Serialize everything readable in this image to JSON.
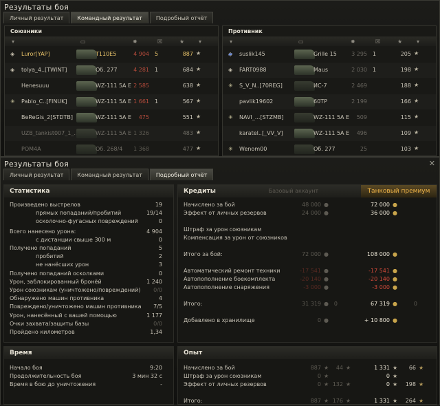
{
  "window1": {
    "title": "Результаты боя",
    "tabs": [
      "Личный результат",
      "Командный результат",
      "Подробный отчёт"
    ],
    "allies_label": "Союзники",
    "enemies_label": "Противник",
    "allies": [
      {
        "name": "Luror[YAP]",
        "tank": "T110E5",
        "damage": "4 904",
        "frags": "5",
        "xp": "887"
      },
      {
        "name": "tolya_4..[TWINT]",
        "tank": "Об. 277",
        "damage": "4 281",
        "frags": "1",
        "xp": "684"
      },
      {
        "name": "Henesuuu",
        "tank": "WZ-111 5A E",
        "damage": "2 585",
        "frags": "",
        "xp": "638"
      },
      {
        "name": "Pablo_C..[FINUK]",
        "tank": "WZ-111 5A E",
        "damage": "1 661",
        "frags": "1",
        "xp": "567"
      },
      {
        "name": "BeReGis_2[STDTB]",
        "tank": "WZ-111 5A E",
        "damage": "475",
        "frags": "",
        "xp": "551"
      },
      {
        "name": "UZB_tankist007_1_...",
        "tank": "WZ-111 5A E",
        "damage": "1 326",
        "frags": "",
        "xp": "483"
      },
      {
        "name": "POM4A",
        "tank": "Об. 268/4",
        "damage": "1 368",
        "frags": "",
        "xp": "477"
      }
    ],
    "enemies": [
      {
        "name": "suslik145",
        "tank": "Grille 15",
        "damage": "3 295",
        "frags": "1",
        "xp": "205"
      },
      {
        "name": "FART0988",
        "tank": "Maus",
        "damage": "2 030",
        "frags": "1",
        "xp": "198"
      },
      {
        "name": "S_V_N..[70REG]",
        "tank": "ИС-7",
        "damage": "2 469",
        "frags": "",
        "xp": "188"
      },
      {
        "name": "pavlik19602",
        "tank": "60TP",
        "damage": "2 199",
        "frags": "",
        "xp": "166"
      },
      {
        "name": "NAVI_...[STZMB]",
        "tank": "WZ-111 5A E",
        "damage": "509",
        "frags": "",
        "xp": "115"
      },
      {
        "name": "karatel..[_VV_V]",
        "tank": "WZ-111 5A E",
        "damage": "496",
        "frags": "",
        "xp": "109"
      },
      {
        "name": "Wenom00",
        "tank": "Об. 277",
        "damage": "25",
        "frags": "",
        "xp": "103"
      }
    ]
  },
  "window2": {
    "title": "Результаты боя",
    "tabs": [
      "Личный результат",
      "Командный результат",
      "Подробный отчёт"
    ],
    "stats_title": "Статистика",
    "stats": [
      {
        "label": "Произведено выстрелов",
        "value": "19",
        "indent": 0
      },
      {
        "label": "прямых попаданий/пробитий",
        "value": "19/14",
        "indent": 1
      },
      {
        "label": "осколочно-фугасных повреждений",
        "value": "0",
        "indent": 1
      },
      {
        "label": "Всего нанесено урона:",
        "value": "4 904",
        "indent": 0
      },
      {
        "label": "с дистанции свыше 300 м",
        "value": "0",
        "indent": 1
      },
      {
        "label": "Получено попаданий",
        "value": "5",
        "indent": 0
      },
      {
        "label": "пробитий",
        "value": "2",
        "indent": 1
      },
      {
        "label": "не нанёсших урон",
        "value": "3",
        "indent": 1
      },
      {
        "label": "Получено попаданий осколками",
        "value": "0",
        "indent": 0
      },
      {
        "label": "Урон, заблокированный бронёй",
        "value": "1 240",
        "indent": 0
      },
      {
        "label": "Урон союзникам (уничтожено/повреждений)",
        "value": "0/0",
        "indent": 0
      },
      {
        "label": "Обнаружено машин противника",
        "value": "4",
        "indent": 0
      },
      {
        "label": "Повреждено/уничтожено машин противника",
        "value": "7/5",
        "indent": 0
      },
      {
        "label": "Урон, нанесённый с вашей помощью",
        "value": "1 177",
        "indent": 0
      },
      {
        "label": "Очки захвата/защиты базы",
        "value": "0/0",
        "indent": 0
      },
      {
        "label": "Пройдено километров",
        "value": "1,34",
        "indent": 0
      }
    ],
    "time_title": "Время",
    "time": [
      {
        "label": "Начало боя",
        "value": "9:20"
      },
      {
        "label": "Продолжительность боя",
        "value": "3 мин 32 с"
      },
      {
        "label": "Время в бою до уничтожения",
        "value": "-"
      }
    ],
    "credits_title": "Кредиты",
    "base_account": "Базовый аккаунт",
    "premium": "Танковый премиум",
    "credits": [
      {
        "label": "Начислено за бой",
        "base": "48 000",
        "prem": "72 000",
        "icon": true
      },
      {
        "label": "Эффект от личных резервов",
        "base": "24 000",
        "prem": "36 000",
        "icon": true
      },
      {
        "label": "Штраф за урон союзникам",
        "base": "",
        "prem": "",
        "icon": false
      },
      {
        "label": "Компенсация за урон от союзников",
        "base": "",
        "prem": "",
        "icon": false
      },
      {
        "label": "Итого за бой:",
        "base": "72 000",
        "prem": "108 000",
        "icon": true
      },
      {
        "label": "Автоматический ремонт техники",
        "base": "-17 541",
        "prem": "-17 541",
        "icon": true,
        "neg": true
      },
      {
        "label": "Автопополнение боекомплекта",
        "base": "-20 140",
        "prem": "-20 140",
        "icon": true,
        "neg": true
      },
      {
        "label": "Автопополнение снаряжения",
        "base": "-3 000",
        "prem": "-3 000",
        "icon": true,
        "neg": true
      },
      {
        "label": "Итого:",
        "base": "31 319",
        "prem": "67 319",
        "icon": true,
        "extra_base": "0",
        "extra_prem": "0"
      },
      {
        "label": "Добавлено в хранилище",
        "base": "0",
        "prem": "+ 10 800",
        "icon": true
      }
    ],
    "xp_title": "Опыт",
    "xp": [
      {
        "label": "Начислено за бой",
        "base": "887",
        "base2": "44",
        "prem": "1 331",
        "prem2": "66"
      },
      {
        "label": "Штраф за урон союзникам",
        "base": "0",
        "base2": "",
        "prem": "0",
        "prem2": ""
      },
      {
        "label": "Эффект от личных резервов",
        "base": "0",
        "base2": "132",
        "prem": "0",
        "prem2": "198"
      },
      {
        "label": "Итого:",
        "base": "887",
        "base2": "176",
        "prem": "1 331",
        "prem2": "264"
      }
    ]
  }
}
